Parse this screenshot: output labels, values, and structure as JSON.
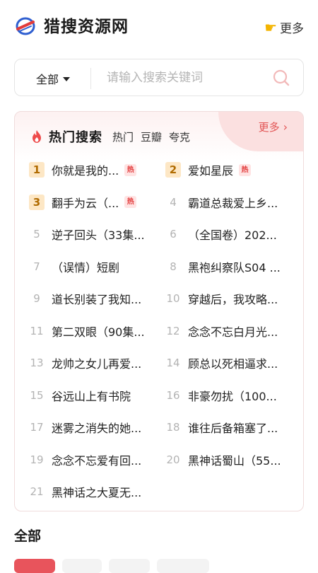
{
  "header": {
    "app_title": "猎搜资源网",
    "more_label": "更多",
    "more_icon": "pointing-hand-icon"
  },
  "search": {
    "category": "全部",
    "placeholder": "请输入搜索关键词",
    "value": ""
  },
  "hot": {
    "title": "热门搜索",
    "tabs": [
      "热门",
      "豆瓣",
      "夸克"
    ],
    "more_label": "更多",
    "badge_label": "热",
    "left": [
      {
        "rank": "1",
        "title": "你就是我的...",
        "hot": true
      },
      {
        "rank": "3",
        "title": "翻手为云（...",
        "hot": true
      },
      {
        "rank": "5",
        "title": "逆子回头（33集...",
        "hot": false
      },
      {
        "rank": "7",
        "title": "（误情）短剧",
        "hot": false
      },
      {
        "rank": "9",
        "title": "道长别装了我知...",
        "hot": false
      },
      {
        "rank": "11",
        "title": "第二双眼（90集...",
        "hot": false
      },
      {
        "rank": "13",
        "title": "龙帅之女儿再爱...",
        "hot": false
      },
      {
        "rank": "15",
        "title": "谷远山上有书院",
        "hot": false
      },
      {
        "rank": "17",
        "title": "迷雾之消失的她...",
        "hot": false
      },
      {
        "rank": "19",
        "title": "念念不忘爱有回...",
        "hot": false
      },
      {
        "rank": "21",
        "title": "黑神话之大夏无...",
        "hot": false
      }
    ],
    "right": [
      {
        "rank": "2",
        "title": "爱如星辰",
        "hot": true
      },
      {
        "rank": "4",
        "title": "霸道总裁爱上乡...",
        "hot": false
      },
      {
        "rank": "6",
        "title": "（全国卷）202...",
        "hot": false
      },
      {
        "rank": "8",
        "title": "黑袍纠察队S04 ...",
        "hot": false
      },
      {
        "rank": "10",
        "title": "穿越后，我攻略...",
        "hot": false
      },
      {
        "rank": "12",
        "title": "念念不忘白月光...",
        "hot": false
      },
      {
        "rank": "14",
        "title": "顾总以死相逼求...",
        "hot": false
      },
      {
        "rank": "16",
        "title": "非豪勿扰（100...",
        "hot": false
      },
      {
        "rank": "18",
        "title": "谁往后备箱塞了...",
        "hot": false
      },
      {
        "rank": "20",
        "title": "黑神话蜀山（55...",
        "hot": false
      }
    ]
  },
  "section": {
    "title": "全部"
  },
  "colors": {
    "accent": "#e8545c",
    "top_rank_bg": "#fde7c5",
    "hot_badge": "#e23b3b"
  }
}
